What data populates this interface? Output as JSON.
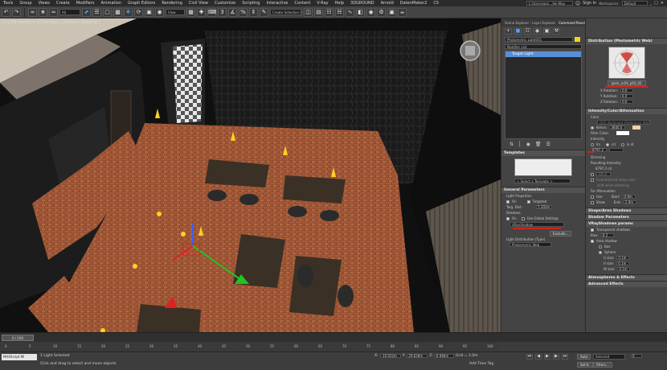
{
  "menu": {
    "items": [
      "Tools",
      "Group",
      "Views",
      "Create",
      "Modifiers",
      "Animation",
      "Graph Editors",
      "Rendering",
      "Civil View",
      "Customize",
      "Scripting",
      "Interactive",
      "Content",
      "V-Ray",
      "Help",
      "3DGROUND",
      "Arnold",
      "DatenMaker2",
      "CS"
    ],
    "workspace_label": "Workspaces:",
    "workspace_value": "Default",
    "sign_in": "Sign In",
    "file_path": "C:\\Users\\gon...Ver.Max",
    "window_controls": [
      "_",
      "□",
      "✕"
    ]
  },
  "toolbar": {
    "selection_filter": "All",
    "view_dropdown": "View",
    "named_selection": "Create Selection Set"
  },
  "viewport": {
    "label": "[+] [Perspective ] [Standard ] [Default Shading ]"
  },
  "command_panel": {
    "tabs": [
      "Scene Explorer - Layer Explorer",
      "Command Panel"
    ],
    "object_name": "Photometric Light001",
    "modifier_list": "Modifier List",
    "stack_item": "Target Light",
    "templates": {
      "title": "Templates",
      "select": "< Select a Template >"
    },
    "general": {
      "title": "General Parameters",
      "light_properties": "Light Properties",
      "on_label": "On",
      "targeted_label": "Targeted",
      "targ_dist_label": "Targ. Dist:",
      "targ_dist_value": "5.302m",
      "shadows_label": "Shadows",
      "shadows_on": "On",
      "use_global": "Use Global Settings",
      "shadow_type": "VRayShadow",
      "exclude_btn": "Exclude...",
      "distribution_label": "Light Distribution (Type)",
      "distribution_value": "Photometric Web"
    }
  },
  "right_panel": {
    "distribution": {
      "title": "Distribution (Photometric Web)",
      "file": "ipom_sc04_p03_02",
      "x_rotation_label": "X Rotation:",
      "x_rotation": "0.0",
      "y_rotation_label": "Y Rotation:",
      "y_rotation": "0.0",
      "z_rotation_label": "Z Rotation:",
      "z_rotation": "0.0"
    },
    "intensity": {
      "title": "Intensity/Color/Attenuation",
      "color_label": "Color",
      "preset": "D65 Illuminant (Reference White)",
      "kelvin_label": "Kelvin:",
      "kelvin": "3600.0",
      "filter_color": "Filter Color:",
      "intensity_label": "Intensity",
      "lm": "lm",
      "cd": "cd",
      "lx": "lx at",
      "intensity_value": "8797.2",
      "dimming": "Dimming",
      "resulting": "Resulting Intensity:",
      "resulting_value": "8797.2 cd",
      "percent": "100.0",
      "incandescent": "Incandescent lamp color",
      "shift": "shift when dimming",
      "far_atten": "Far Attenuation",
      "use": "Use",
      "show": "Show",
      "start_label": "Start:",
      "start": "0.8m",
      "end_label": "End:",
      "end": "2.0m"
    },
    "shape": "Shape/Area Shadows",
    "shadow_params": "Shadow Parameters",
    "vrayshadows": {
      "title": "VRayShadows params",
      "transparent": "Transparent shadows",
      "bias_label": "Bias:",
      "bias": "0.2",
      "area_shadow": "Area shadow",
      "box": "Box",
      "sphere": "Sphere",
      "u_size_label": "U size:",
      "u_size": "0.1m",
      "v_size_label": "V size:",
      "v_size": "0.1m",
      "w_size_label": "W size:",
      "w_size": "0.1m"
    },
    "atmospheres": "Atmospheres & Effects",
    "advanced": "Advanced Effects"
  },
  "timeline": {
    "frame_label": "0 / 100",
    "ticks": [
      "0",
      "5",
      "10",
      "15",
      "20",
      "25",
      "30",
      "35",
      "40",
      "45",
      "50",
      "55",
      "60",
      "65",
      "70",
      "75",
      "80",
      "85",
      "90",
      "95",
      "100"
    ]
  },
  "status": {
    "maxscript": "MAXScript Mi",
    "line1": "1 Light Selected",
    "line2": "Click and drag to select and move objects",
    "x_label": "X:",
    "x_value": "-10.922m",
    "y_label": "Y:",
    "y_value": "29.626m",
    "z_label": "Z:",
    "z_value": "6.946m",
    "grid": "Grid = 1.0m",
    "add_time_tag": "Add Time Tag",
    "auto": "Auto",
    "set_key": "Set K.",
    "selected": "Selected",
    "filters": "Filters...",
    "frame": "0"
  },
  "colors": {
    "accent_red": "#d0241e",
    "selection_blue": "#5a8fd6",
    "panel_bg": "#444444"
  }
}
